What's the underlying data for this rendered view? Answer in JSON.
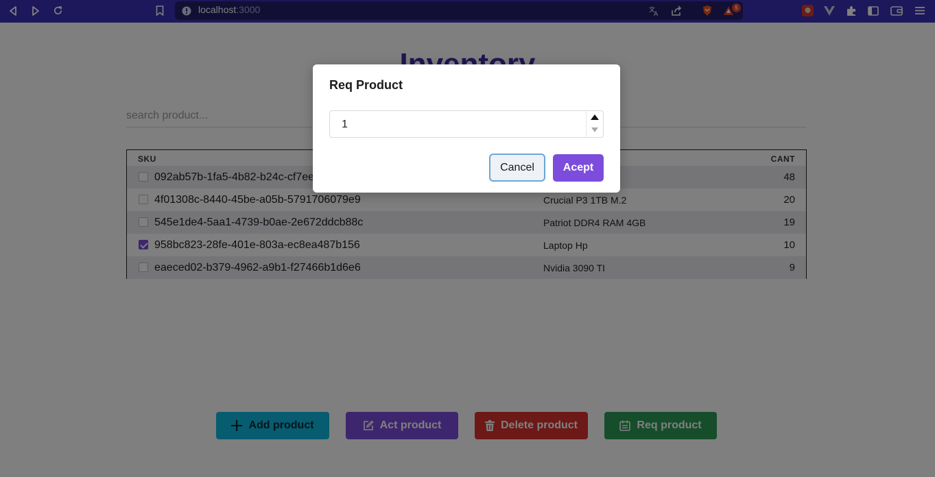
{
  "browser": {
    "url_host": "localhost",
    "url_port": ":3000",
    "alerts_badge": "5"
  },
  "page": {
    "title": "Inventory",
    "search_placeholder": "search product...",
    "table": {
      "headers": {
        "sku": "SKU",
        "cant": "CANT"
      },
      "rows": [
        {
          "sku": "092ab57b-1fa5-4b82-b24c-cf7ee",
          "name": "",
          "cant": "48",
          "checked": false
        },
        {
          "sku": "4f01308c-8440-45be-a05b-5791706079e9",
          "name": "Crucial P3 1TB M.2",
          "cant": "20",
          "checked": false
        },
        {
          "sku": "545e1de4-5aa1-4739-b0ae-2e672ddcb88c",
          "name": "Patriot DDR4 RAM 4GB",
          "cant": "19",
          "checked": false
        },
        {
          "sku": "958bc823-28fe-401e-803a-ec8ea487b156",
          "name": "Laptop Hp",
          "cant": "10",
          "checked": true
        },
        {
          "sku": "eaeced02-b379-4962-a9b1-f27466b1d6e6",
          "name": "Nvidia 3090 TI",
          "cant": "9",
          "checked": false
        }
      ]
    },
    "buttons": {
      "add": "Add product",
      "act": "Act product",
      "delete": "Delete product",
      "req": "Req product"
    }
  },
  "modal": {
    "title": "Req Product",
    "quantity": "1",
    "cancel": "Cancel",
    "accept": "Acept"
  },
  "colors": {
    "accent_purple": "#7c4ddc",
    "add_cyan": "#0fb8e0",
    "delete_red": "#d8322e",
    "req_green": "#2c9a57",
    "browser_toolbar": "#3b2fb6"
  }
}
